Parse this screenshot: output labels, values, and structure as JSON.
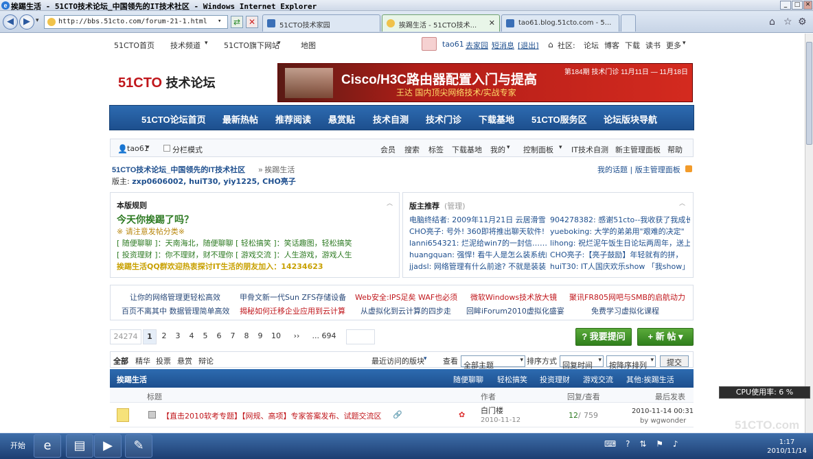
{
  "window": {
    "title": "挨踢生活 - 51CTO技术论坛_中国领先的IT技术社区 - Windows Internet Explorer",
    "url": "http://bbs.51cto.com/forum-21-1.html",
    "tabs": [
      {
        "label": "51CTO技术家园",
        "active": false
      },
      {
        "label": "挨踢生活 - 51CTO技术...",
        "active": true
      },
      {
        "label": "tao61.blog.51cto.com - 5...",
        "active": false
      }
    ]
  },
  "topnav": {
    "items": [
      "51CTO首页",
      "技术频道",
      "51CTO旗下网站",
      "地图"
    ],
    "user": "tao61",
    "links": [
      "去家园",
      "短消息",
      "[退出]"
    ],
    "community_label": "社区:",
    "community": [
      "论坛",
      "博客",
      "下载",
      "读书",
      "更多"
    ]
  },
  "logo": {
    "brand": "51CTO",
    "suffix": "技术论坛"
  },
  "banner": {
    "headline": "Cisco/H3C路由器配置入门与提高",
    "sub": "王达  国内顶尖网络技术/实战专家",
    "issue": "第184期  技术门诊  11月11日 — 11月18日"
  },
  "mainnav": [
    "51CTO论坛首页",
    "最新热帖",
    "推荐阅读",
    "悬赏贴",
    "技术自测",
    "技术门诊",
    "下载基地",
    "51CTO服务区",
    "论坛版块导航"
  ],
  "userbar": {
    "user": "tao61",
    "mode": "分栏模式",
    "links": [
      "会员",
      "搜索",
      "标签",
      "下载基地",
      "我的",
      "控制面板",
      "IT技术自测",
      "新主管理面板",
      "帮助"
    ]
  },
  "breadcrumb": {
    "site": "51CTO技术论坛_中国领先的IT技术社区",
    "sep": "»",
    "current": "挨踢生活",
    "my_topics": "我的话题",
    "admin_panel": "版主管理面板"
  },
  "moderators": {
    "label": "版主:",
    "names": "zxp0606002, huiT30, yiy1225, CHO亮子"
  },
  "rules": {
    "title": "本版规则",
    "headline": "今天你挨踢了吗？",
    "note": "※ 请注意发帖分类※",
    "lines": [
      "[ 随便聊聊 ]：天南海北，随便聊聊 [ 轻松搞笑 ]：笑话趣图，轻松搞笑",
      "[ 投资理财 ]：你不理财，财不理你 [ 游戏交流 ]：人生游戏，游戏人生"
    ],
    "qq": "挨踢生活QQ群欢迎热衷探讨IT生活的朋友加入：14234623"
  },
  "recommend": {
    "title": "版主推荐",
    "manage": "(管理)",
    "left": [
      "电脑终结者: 2009年11月21日 云居滑雪!",
      "CHO亮子: 号外! 360即将推出聊天软件!",
      "lanni654321: 烂泥给win7的一封信……",
      "huangquan: 强悍! 看牛人是怎么装系统的",
      "jjadsl: 网络管理有什么前途? 不就是装装"
    ],
    "right": [
      "904278382: 感谢51cto--我收获了我成长",
      "yueboking: 大学的弟弟用\"艰难的决定\"",
      "lihong: 祝烂泥午饭生日论坛两周年，送上",
      "CHO亮子:【亮子鼓励】年轻就有的拼，",
      "huiT30: IT人国庆欢乐show 「我show」"
    ]
  },
  "ads": {
    "row1": [
      "让你的网络管理更轻松高效",
      "甲骨文新一代Sun ZFS存储设备",
      "Web安全:IPS足矣  WAF也必须",
      "微软Windows技术放大镜",
      "聚讯FR805网吧与SMB的启航动力"
    ],
    "row2": [
      "百页不离其中  数据管理简单高效",
      "揭秘如何迁移企业应用到云计算",
      "从虚拟化到云计算的四步走",
      "回眸iForum2010虚拟化盛宴",
      "免费学习虚拟化课程"
    ]
  },
  "pager": {
    "total": "24274",
    "pages": [
      "1",
      "2",
      "3",
      "4",
      "5",
      "6",
      "7",
      "8",
      "9",
      "10",
      "››",
      "... 694"
    ],
    "current": "1"
  },
  "actions": {
    "ask": "? 我要提问",
    "new": "+ 新  帖 ▾"
  },
  "filter": {
    "tabs": [
      "全部",
      "精华",
      "投票",
      "悬赏",
      "辩论"
    ],
    "recent": "最近访问的版块",
    "view_label": "查看",
    "view_value": "全部主题",
    "sort_label": "排序方式",
    "sort_value": "回复时间",
    "order_value": "按降序排列",
    "submit": "提交"
  },
  "forum": {
    "name": "挨踢生活",
    "categories": [
      "随便聊聊",
      "轻松搞笑",
      "投资理财",
      "游戏交流",
      "其他:挨踢生活"
    ]
  },
  "columns": {
    "title": "标题",
    "author": "作者",
    "replies": "回复/查看",
    "last": "最后发表"
  },
  "threads": [
    {
      "title": "【直击2010软考专题】【网规、高项】专家答案发布、试题交流区",
      "author": "白门楼",
      "date": "2010-11-12",
      "replies": "12",
      "views": "759",
      "last_time": "2010-11-14 00:31",
      "last_by": "by wgwonder"
    }
  ],
  "system": {
    "cpu": "CPU使用率: 6 %",
    "watermark": "51CTO.com",
    "start": "开始",
    "time": "1:17",
    "date": "2010/11/14"
  },
  "colors": {
    "accent": "#1e4f8e",
    "nav": "#2d6bb0",
    "brand": "#c0161b",
    "green_btn": "#3f8f27"
  }
}
